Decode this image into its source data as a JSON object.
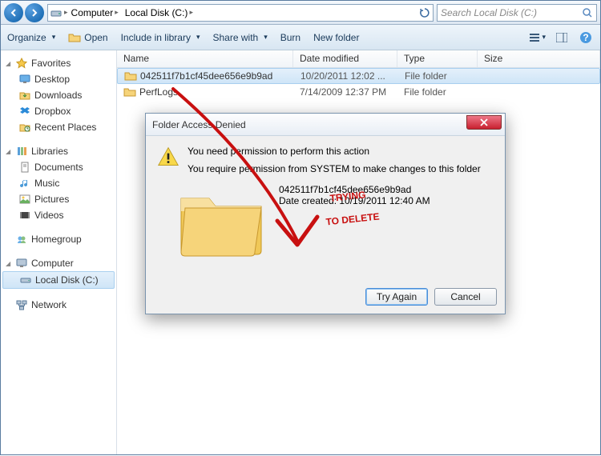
{
  "breadcrumb": {
    "seg1": "Computer",
    "seg2": "Local Disk (C:)"
  },
  "search": {
    "placeholder": "Search Local Disk (C:)"
  },
  "toolbar": {
    "organize": "Organize",
    "open": "Open",
    "include": "Include in library",
    "share": "Share with",
    "burn": "Burn",
    "newfolder": "New folder"
  },
  "sidebar": {
    "favorites": "Favorites",
    "fav_items": [
      "Desktop",
      "Downloads",
      "Dropbox",
      "Recent Places"
    ],
    "libraries": "Libraries",
    "lib_items": [
      "Documents",
      "Music",
      "Pictures",
      "Videos"
    ],
    "homegroup": "Homegroup",
    "computer": "Computer",
    "localdisk": "Local Disk (C:)",
    "network": "Network"
  },
  "columns": {
    "name": "Name",
    "date": "Date modified",
    "type": "Type",
    "size": "Size"
  },
  "rows": [
    {
      "name": "042511f7b1cf45dee656e9b9ad",
      "date": "10/20/2011 12:02 ...",
      "type": "File folder",
      "size": ""
    },
    {
      "name": "PerfLogs",
      "date": "7/14/2009 12:37 PM",
      "type": "File folder",
      "size": ""
    }
  ],
  "dialog": {
    "title": "Folder Access Denied",
    "msg1": "You need permission to perform this action",
    "msg2": "You require permission from SYSTEM to make changes to this folder",
    "fname": "042511f7b1cf45dee656e9b9ad",
    "fcreated": "Date created: 10/19/2011 12:40 AM",
    "tryagain": "Try Again",
    "cancel": "Cancel"
  },
  "annotation": {
    "line1": "TRYING",
    "line2": "TO DELETE"
  }
}
